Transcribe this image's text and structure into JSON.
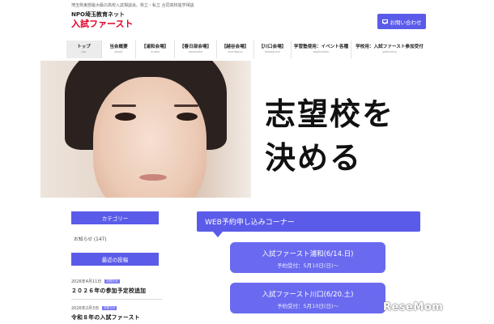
{
  "header": {
    "tagline": "埼玉県東部最大級の高校入試相談会。県立・私立 合同高校進学相談",
    "logo_sub": "NPO埼玉教育ネット",
    "logo_main": "入試ファースト",
    "contact_label": "お問い合わせ"
  },
  "nav": {
    "items": [
      {
        "label": "トップ",
        "sub": "top"
      },
      {
        "label": "当会概要",
        "sub": "about"
      },
      {
        "label": "【浦和会場】",
        "sub": "urawa"
      },
      {
        "label": "【春日部会場】",
        "sub": "kasukabe"
      },
      {
        "label": "【越谷会場】",
        "sub": "koshigaya"
      },
      {
        "label": "【川口会場】",
        "sub": "kawaguchi"
      },
      {
        "label": "学習塾使用：イベント各種",
        "sub": "application"
      },
      {
        "label": "学校用：入試ファースト参加受付",
        "sub": "gathering"
      }
    ]
  },
  "hero": {
    "line1": "志望校を",
    "line2": "決める"
  },
  "sidebar": {
    "category_header": "カテゴリー",
    "category_item": "お知らせ (147)",
    "recent_header": "最近の投稿",
    "posts": [
      {
        "date": "2026年4月11日",
        "badge": "お知らせ",
        "title": "２０２６年の参加予定校追加"
      },
      {
        "date": "2026年2月3日",
        "badge": "お知らせ",
        "title": "令和８年の入試ファースト"
      }
    ]
  },
  "main": {
    "web_header": "WEB予約申し込みコーナー",
    "events": [
      {
        "title": "入試ファースト浦和(6/14.日)",
        "sub": "予約受付：5月10日(日)〜"
      },
      {
        "title": "入試ファースト川口(6/20.土)",
        "sub": "予約受付：5月10日(日)〜"
      }
    ]
  },
  "watermark": "ReseMom",
  "colors": {
    "accent": "#5b5bea",
    "logo_red": "#e0002a"
  }
}
